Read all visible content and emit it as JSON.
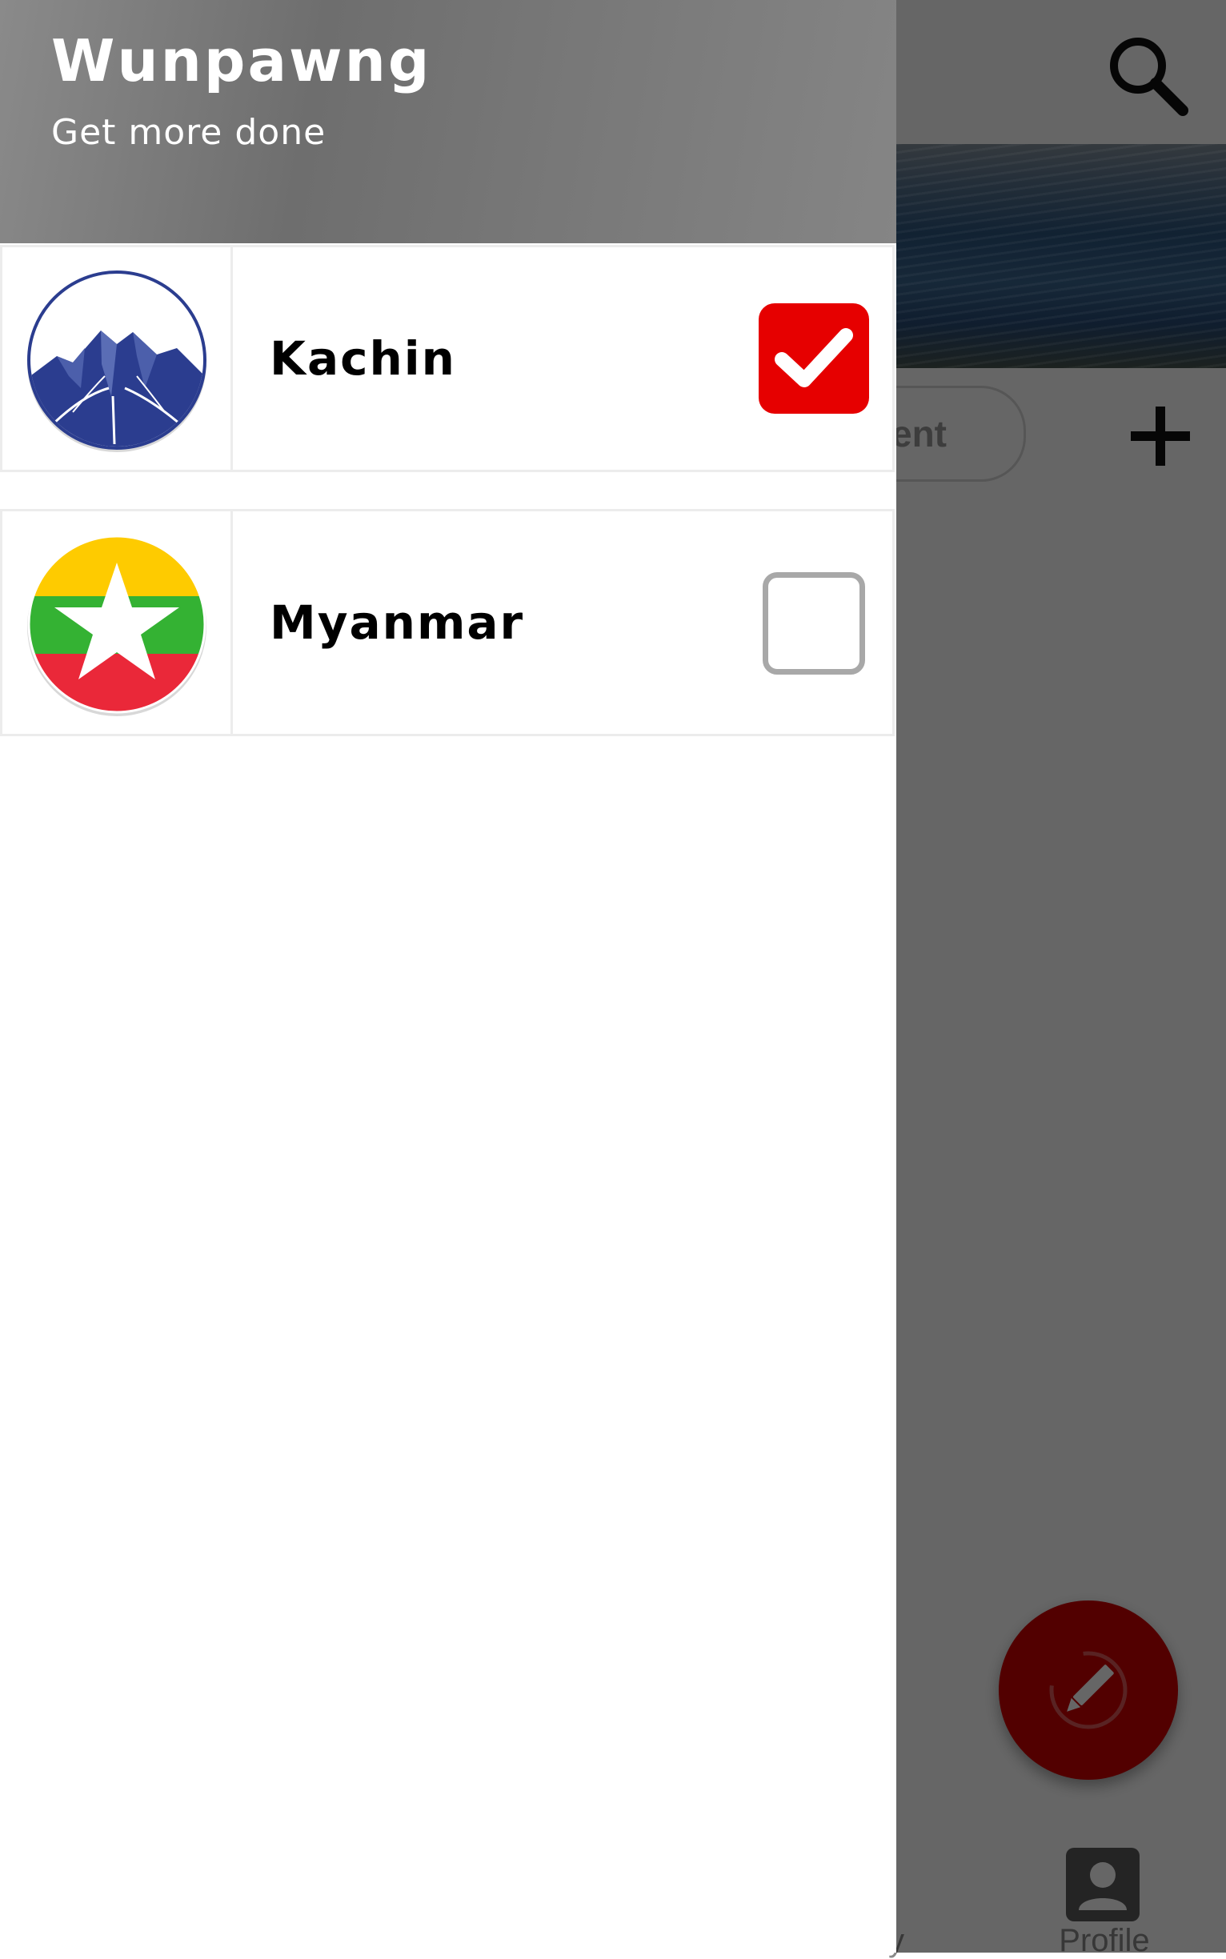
{
  "drawer": {
    "title": "Wunpawng",
    "subtitle": "Get more done",
    "items": [
      {
        "label": "Kachin",
        "checked": true,
        "logo": "kachin-mountain-logo"
      },
      {
        "label": "Myanmar",
        "checked": false,
        "logo": "myanmar-flag-logo"
      }
    ]
  },
  "background": {
    "filter_chip_partial": "ent",
    "bottom_nav": {
      "partial_label": "y",
      "profile_label": "Profile"
    },
    "icons": [
      "search-icon",
      "plus-icon",
      "pencil-icon",
      "profile-icon"
    ]
  },
  "colors": {
    "accent": "#e60000",
    "fab": "#cc0000",
    "drawer_header": "#777777",
    "kachin_blue": "#2b3d8f",
    "myanmar_yellow": "#fecb00",
    "myanmar_green": "#34b233",
    "myanmar_red": "#ea2839"
  }
}
